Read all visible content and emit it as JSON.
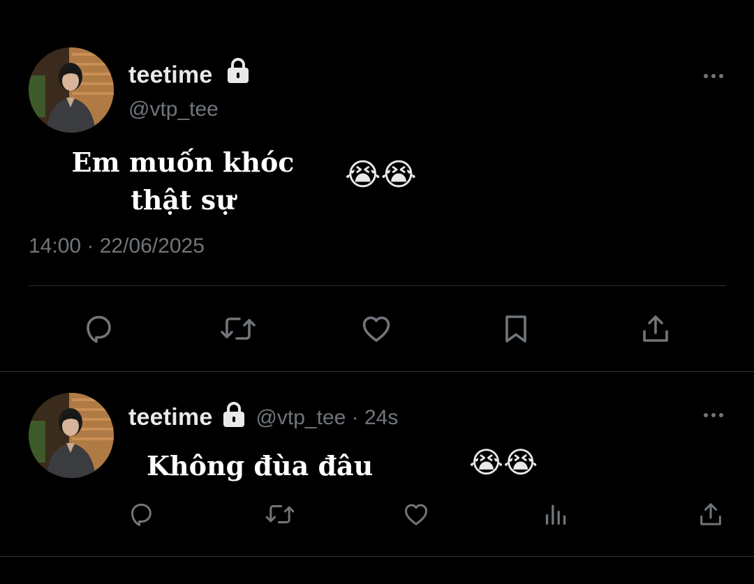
{
  "main_tweet": {
    "display_name": "teetime",
    "handle": "@vtp_tee",
    "text_line1": "Em muốn khóc",
    "text_line2": "thật sự",
    "emoji": "😭😭",
    "timestamp": "14:00 · 22/06/2025",
    "lock_icon": "lock-icon",
    "action_icons": [
      "reply-icon",
      "retweet-icon",
      "like-icon",
      "bookmark-icon",
      "share-icon"
    ]
  },
  "reply": {
    "display_name": "teetime",
    "handle_time": "@vtp_tee · 24s",
    "text": "Không đùa đâu",
    "emoji": "😭😭",
    "action_icons": [
      "reply-icon",
      "retweet-icon",
      "like-icon",
      "views-icon",
      "share-icon"
    ]
  },
  "colors": {
    "background": "#000000",
    "primary_text": "#e7e9ea",
    "secondary_text": "#71767b",
    "divider": "#2f3336"
  }
}
